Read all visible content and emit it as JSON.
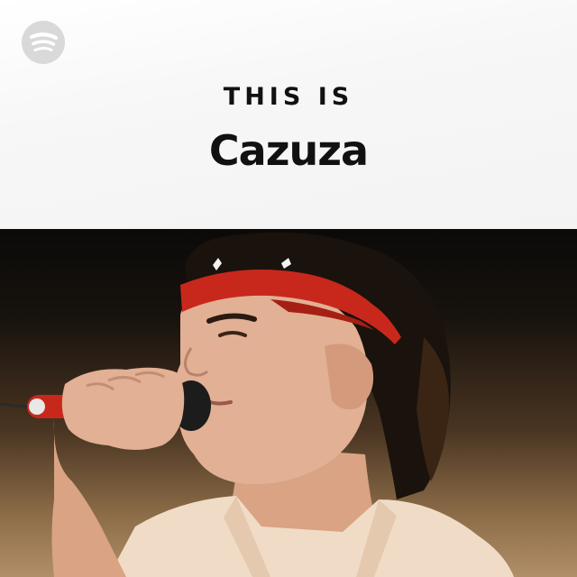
{
  "brand": {
    "logo_icon": "spotify-logo-icon",
    "logo_color": "#d9d9d9"
  },
  "playlist": {
    "kicker": "THIS IS",
    "artist": "Cazuza"
  },
  "photo": {
    "subject": "singer-photo",
    "headband_color": "#c8281c",
    "mic_color": "#c8281c"
  }
}
